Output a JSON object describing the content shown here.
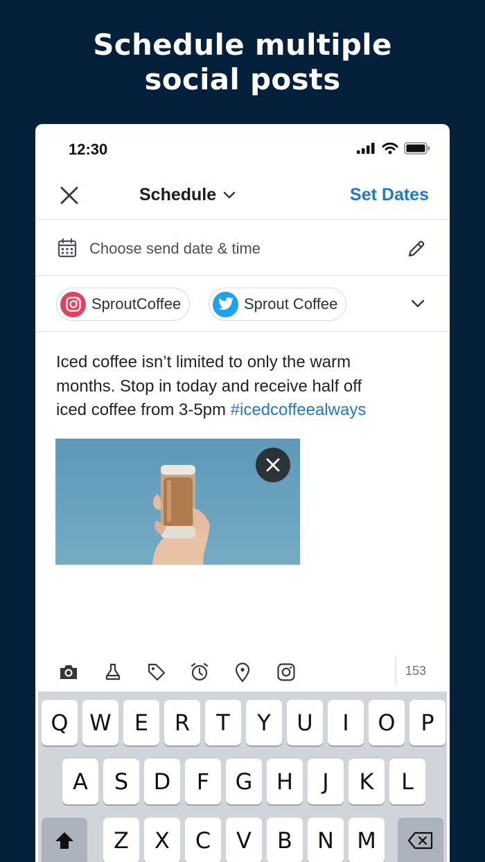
{
  "headline": {
    "line1": "Schedule multiple",
    "line2": "social posts"
  },
  "status_bar": {
    "time": "12:30"
  },
  "nav": {
    "close_icon": "close-icon",
    "title": "Schedule",
    "action": "Set Dates"
  },
  "date_row": {
    "label": "Choose send date & time"
  },
  "profiles": [
    {
      "network": "instagram",
      "name": "SproutCoffee",
      "color": "#e4405f"
    },
    {
      "network": "twitter",
      "name": "Sprout Coffee",
      "color": "#1da1f2"
    }
  ],
  "compose": {
    "text_line1": "Iced coffee isn’t limited to only the warm",
    "text_line2": "months. Stop in today and receive half off",
    "text_line3_prefix": "iced coffee from 3-5pm ",
    "hashtag": "#icedcoffeealways"
  },
  "toolbar": {
    "icons": [
      "camera-icon",
      "lab-flask-icon",
      "tag-icon",
      "alarm-clock-icon",
      "location-pin-icon",
      "instagram-icon"
    ],
    "character_count": "153"
  },
  "keyboard": {
    "row1": [
      "Q",
      "W",
      "E",
      "R",
      "T",
      "Y",
      "U",
      "I",
      "O",
      "P"
    ],
    "row2": [
      "A",
      "S",
      "D",
      "F",
      "G",
      "H",
      "J",
      "K",
      "L"
    ],
    "row3": [
      "Z",
      "X",
      "C",
      "V",
      "B",
      "N",
      "M"
    ]
  },
  "colors": {
    "background": "#04203a",
    "accent": "#2278c9",
    "instagram": "#e4405f",
    "twitter": "#1da1f2"
  }
}
